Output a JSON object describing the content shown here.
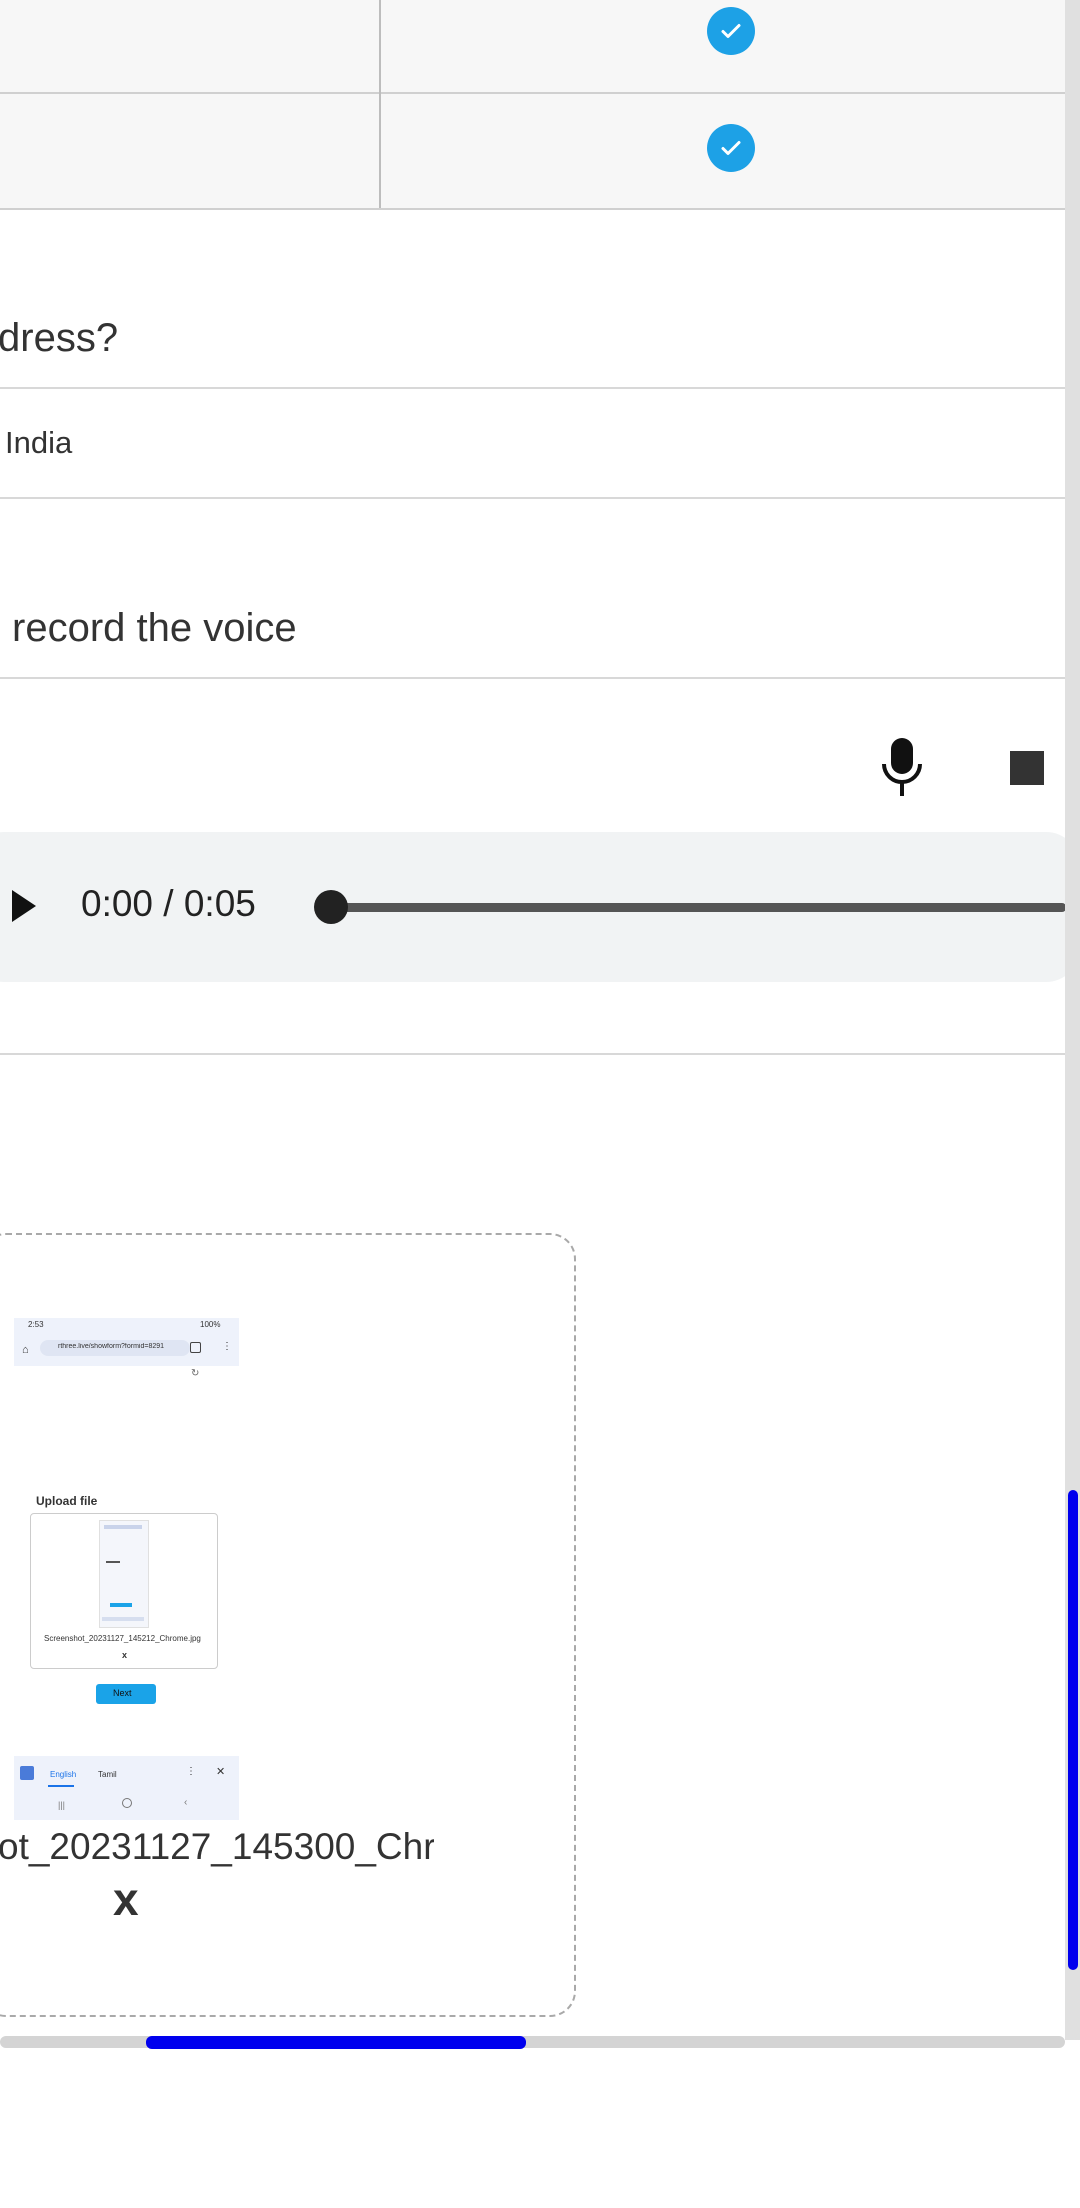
{
  "grid": {
    "rows": [
      {
        "checked": true
      },
      {
        "checked": true
      }
    ]
  },
  "question_address": {
    "label": "dress?",
    "answer": "India"
  },
  "question_voice": {
    "label": "record the voice",
    "mic_icon": "microphone-icon",
    "stop_icon": "stop-icon"
  },
  "audio_player": {
    "time_display": "0:00 / 0:05",
    "progress": 0.0
  },
  "upload": {
    "filename": "ot_20231127_145300_Chr",
    "remove_label": "x",
    "preview": {
      "status_time": "2:53",
      "status_battery": "100%",
      "url": "rthree.live/showform?formid=8291",
      "title": "Upload file",
      "inner_filename": "Screenshot_20231127_145212_Chrome.jpg",
      "inner_remove": "x",
      "next_label": "Next",
      "lang_english": "English",
      "lang_tamil": "Tamil"
    }
  },
  "colors": {
    "check": "#1da1e6",
    "scroll_thumb": "#0000ee",
    "next_button": "#1aa3e8"
  }
}
